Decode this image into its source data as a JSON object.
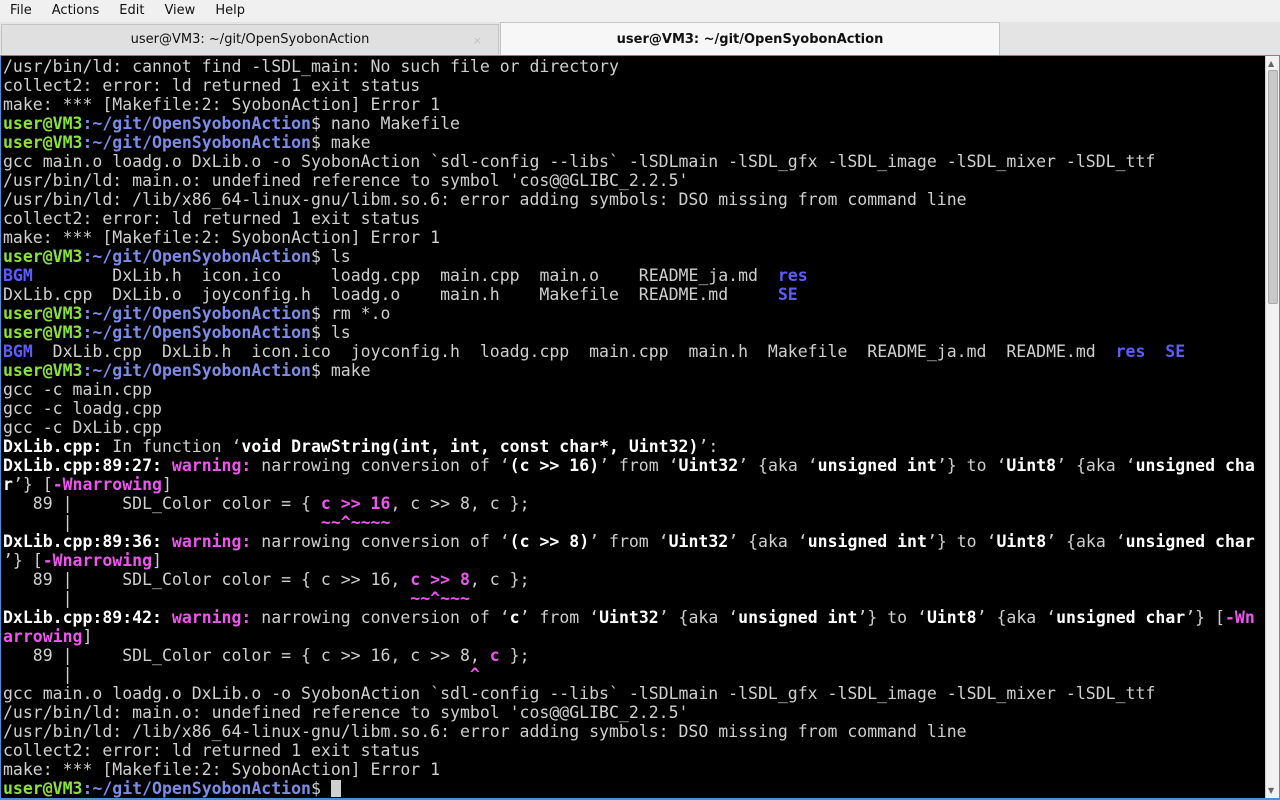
{
  "menubar": {
    "items": [
      "File",
      "Actions",
      "Edit",
      "View",
      "Help"
    ]
  },
  "tabs": [
    {
      "label": "user@VM3: ~/git/OpenSyobonAction",
      "active": false,
      "close_glyph": "×"
    },
    {
      "label": "user@VM3: ~/git/OpenSyobonAction",
      "active": true
    }
  ],
  "terminal": {
    "prompt_user": "user@VM3",
    "prompt_path": ":~/git/OpenSyobonAction",
    "lines": [
      [
        {
          "t": "/usr/bin/ld: cannot find -lSDL_main: No such file or directory",
          "c": "n"
        }
      ],
      [
        {
          "t": "collect2: error: ld returned 1 exit status",
          "c": "n"
        }
      ],
      [
        {
          "t": "make: *** [Makefile:2: SyobonAction] Error 1",
          "c": "n"
        }
      ],
      [
        {
          "t": "user@VM3",
          "c": "pu"
        },
        {
          "t": ":~/git/OpenSyobonAction",
          "c": "pp"
        },
        {
          "t": "$ nano Makefile",
          "c": "n"
        }
      ],
      [
        {
          "t": "user@VM3",
          "c": "pu"
        },
        {
          "t": ":~/git/OpenSyobonAction",
          "c": "pp"
        },
        {
          "t": "$ make",
          "c": "n"
        }
      ],
      [
        {
          "t": "gcc main.o loadg.o DxLib.o -o SyobonAction `sdl-config --libs` -lSDLmain -lSDL_gfx -lSDL_image -lSDL_mixer -lSDL_ttf",
          "c": "n"
        }
      ],
      [
        {
          "t": "/usr/bin/ld: main.o: undefined reference to symbol 'cos@@GLIBC_2.2.5'",
          "c": "n"
        }
      ],
      [
        {
          "t": "/usr/bin/ld: /lib/x86_64-linux-gnu/libm.so.6: error adding symbols: DSO missing from command line",
          "c": "n"
        }
      ],
      [
        {
          "t": "collect2: error: ld returned 1 exit status",
          "c": "n"
        }
      ],
      [
        {
          "t": "make: *** [Makefile:2: SyobonAction] Error 1",
          "c": "n"
        }
      ],
      [
        {
          "t": "user@VM3",
          "c": "pu"
        },
        {
          "t": ":~/git/OpenSyobonAction",
          "c": "pp"
        },
        {
          "t": "$ ls",
          "c": "n"
        }
      ],
      [
        {
          "t": "BGM",
          "c": "d"
        },
        {
          "t": "        DxLib.h  icon.ico     loadg.cpp  main.cpp  main.o    README_ja.md  ",
          "c": "n"
        },
        {
          "t": "res",
          "c": "d"
        }
      ],
      [
        {
          "t": "DxLib.cpp  DxLib.o  joyconfig.h  loadg.o    main.h    Makefile  README.md     ",
          "c": "n"
        },
        {
          "t": "SE",
          "c": "d"
        }
      ],
      [
        {
          "t": "user@VM3",
          "c": "pu"
        },
        {
          "t": ":~/git/OpenSyobonAction",
          "c": "pp"
        },
        {
          "t": "$ rm *.o",
          "c": "n"
        }
      ],
      [
        {
          "t": "user@VM3",
          "c": "pu"
        },
        {
          "t": ":~/git/OpenSyobonAction",
          "c": "pp"
        },
        {
          "t": "$ ls",
          "c": "n"
        }
      ],
      [
        {
          "t": "BGM",
          "c": "d"
        },
        {
          "t": "  DxLib.cpp  DxLib.h  icon.ico  joyconfig.h  loadg.cpp  main.cpp  main.h  Makefile  README_ja.md  README.md  ",
          "c": "n"
        },
        {
          "t": "res",
          "c": "d"
        },
        {
          "t": "  ",
          "c": "n"
        },
        {
          "t": "SE",
          "c": "d"
        }
      ],
      [
        {
          "t": "user@VM3",
          "c": "pu"
        },
        {
          "t": ":~/git/OpenSyobonAction",
          "c": "pp"
        },
        {
          "t": "$ make",
          "c": "n"
        }
      ],
      [
        {
          "t": "gcc -c main.cpp",
          "c": "n"
        }
      ],
      [
        {
          "t": "gcc -c loadg.cpp",
          "c": "n"
        }
      ],
      [
        {
          "t": "gcc -c DxLib.cpp",
          "c": "n"
        }
      ],
      [
        {
          "t": "DxLib.cpp:",
          "c": "b"
        },
        {
          "t": " In function ‘",
          "c": "n"
        },
        {
          "t": "void DrawString(int, int, const char*, Uint32)",
          "c": "b"
        },
        {
          "t": "’:",
          "c": "n"
        }
      ],
      [
        {
          "t": "DxLib.cpp:89:27: ",
          "c": "b"
        },
        {
          "t": "warning: ",
          "c": "w"
        },
        {
          "t": "narrowing conversion of ‘",
          "c": "n"
        },
        {
          "t": "(c >> 16)",
          "c": "b"
        },
        {
          "t": "’ from ‘",
          "c": "n"
        },
        {
          "t": "Uint32",
          "c": "b"
        },
        {
          "t": "’ {aka ‘",
          "c": "n"
        },
        {
          "t": "unsigned int",
          "c": "b"
        },
        {
          "t": "’} to ‘",
          "c": "n"
        },
        {
          "t": "Uint8",
          "c": "b"
        },
        {
          "t": "’ {aka ‘",
          "c": "n"
        },
        {
          "t": "unsigned cha",
          "c": "b"
        }
      ],
      [
        {
          "t": "r",
          "c": "b"
        },
        {
          "t": "’} [",
          "c": "n"
        },
        {
          "t": "-Wnarrowing",
          "c": "w"
        },
        {
          "t": "]",
          "c": "n"
        }
      ],
      [
        {
          "t": "   89 |     SDL_Color color = { ",
          "c": "n"
        },
        {
          "t": "c >> 16",
          "c": "w"
        },
        {
          "t": ", c >> 8, c };",
          "c": "n"
        }
      ],
      [
        {
          "t": "      |                         ",
          "c": "n"
        },
        {
          "t": "~~^~~~~",
          "c": "w"
        }
      ],
      [
        {
          "t": "DxLib.cpp:89:36: ",
          "c": "b"
        },
        {
          "t": "warning: ",
          "c": "w"
        },
        {
          "t": "narrowing conversion of ‘",
          "c": "n"
        },
        {
          "t": "(c >> 8)",
          "c": "b"
        },
        {
          "t": "’ from ‘",
          "c": "n"
        },
        {
          "t": "Uint32",
          "c": "b"
        },
        {
          "t": "’ {aka ‘",
          "c": "n"
        },
        {
          "t": "unsigned int",
          "c": "b"
        },
        {
          "t": "’} to ‘",
          "c": "n"
        },
        {
          "t": "Uint8",
          "c": "b"
        },
        {
          "t": "’ {aka ‘",
          "c": "n"
        },
        {
          "t": "unsigned char",
          "c": "b"
        }
      ],
      [
        {
          "t": "’} [",
          "c": "n"
        },
        {
          "t": "-Wnarrowing",
          "c": "w"
        },
        {
          "t": "]",
          "c": "n"
        }
      ],
      [
        {
          "t": "   89 |     SDL_Color color = { c >> 16, ",
          "c": "n"
        },
        {
          "t": "c >> 8",
          "c": "w"
        },
        {
          "t": ", c };",
          "c": "n"
        }
      ],
      [
        {
          "t": "      |                                  ",
          "c": "n"
        },
        {
          "t": "~~^~~~",
          "c": "w"
        }
      ],
      [
        {
          "t": "DxLib.cpp:89:42: ",
          "c": "b"
        },
        {
          "t": "warning: ",
          "c": "w"
        },
        {
          "t": "narrowing conversion of ‘",
          "c": "n"
        },
        {
          "t": "c",
          "c": "b"
        },
        {
          "t": "’ from ‘",
          "c": "n"
        },
        {
          "t": "Uint32",
          "c": "b"
        },
        {
          "t": "’ {aka ‘",
          "c": "n"
        },
        {
          "t": "unsigned int",
          "c": "b"
        },
        {
          "t": "’} to ‘",
          "c": "n"
        },
        {
          "t": "Uint8",
          "c": "b"
        },
        {
          "t": "’ {aka ‘",
          "c": "n"
        },
        {
          "t": "unsigned char",
          "c": "b"
        },
        {
          "t": "’} [",
          "c": "n"
        },
        {
          "t": "-Wn",
          "c": "w"
        }
      ],
      [
        {
          "t": "arrowing",
          "c": "w"
        },
        {
          "t": "]",
          "c": "n"
        }
      ],
      [
        {
          "t": "   89 |     SDL_Color color = { c >> 16, c >> 8, ",
          "c": "n"
        },
        {
          "t": "c",
          "c": "w"
        },
        {
          "t": " };",
          "c": "n"
        }
      ],
      [
        {
          "t": "      |                                        ",
          "c": "n"
        },
        {
          "t": "^",
          "c": "w"
        }
      ],
      [
        {
          "t": "gcc main.o loadg.o DxLib.o -o SyobonAction `sdl-config --libs` -lSDLmain -lSDL_gfx -lSDL_image -lSDL_mixer -lSDL_ttf",
          "c": "n"
        }
      ],
      [
        {
          "t": "/usr/bin/ld: main.o: undefined reference to symbol 'cos@@GLIBC_2.2.5'",
          "c": "n"
        }
      ],
      [
        {
          "t": "/usr/bin/ld: /lib/x86_64-linux-gnu/libm.so.6: error adding symbols: DSO missing from command line",
          "c": "n"
        }
      ],
      [
        {
          "t": "collect2: error: ld returned 1 exit status",
          "c": "n"
        }
      ],
      [
        {
          "t": "make: *** [Makefile:2: SyobonAction] Error 1",
          "c": "n"
        }
      ],
      [
        {
          "t": "user@VM3",
          "c": "pu"
        },
        {
          "t": ":~/git/OpenSyobonAction",
          "c": "pp"
        },
        {
          "t": "$ ",
          "c": "n"
        },
        {
          "t": "",
          "c": "cursor"
        }
      ]
    ]
  },
  "colors": {
    "background": "#000000",
    "text": "#cfcfcf",
    "prompt_user": "#8ae234",
    "prompt_path": "#7b8ce8",
    "directory": "#5c5cff",
    "warning": "#ee55ee",
    "frame_accent": "#4a90d9"
  },
  "icons": {
    "tab_close": "close-icon",
    "scroll_up": "scroll-up-arrow-icon",
    "scroll_down": "scroll-down-arrow-icon"
  }
}
